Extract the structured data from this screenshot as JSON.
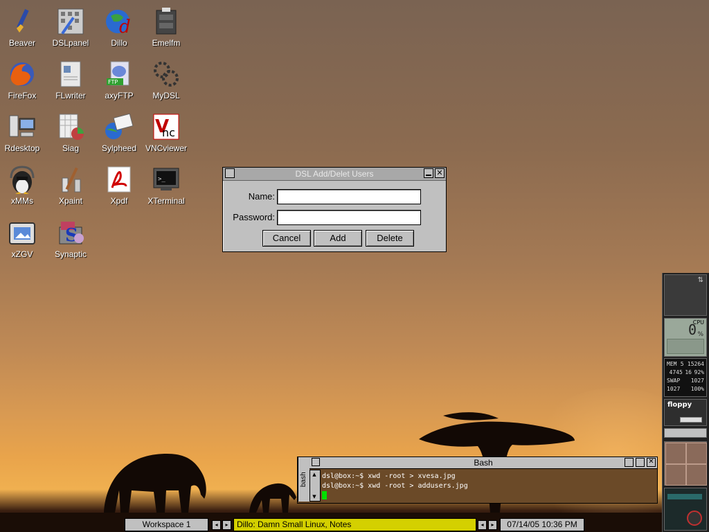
{
  "desktop_icons": [
    {
      "label": "Beaver",
      "icon": "beaver-icon"
    },
    {
      "label": "DSLpanel",
      "icon": "dslpanel-icon"
    },
    {
      "label": "Dillo",
      "icon": "dillo-icon"
    },
    {
      "label": "Emelfm",
      "icon": "emelfm-icon"
    },
    {
      "label": "FireFox",
      "icon": "firefox-icon"
    },
    {
      "label": "FLwriter",
      "icon": "flwriter-icon"
    },
    {
      "label": "axyFTP",
      "icon": "axyftp-icon"
    },
    {
      "label": "MyDSL",
      "icon": "mydsl-icon"
    },
    {
      "label": "Rdesktop",
      "icon": "rdesktop-icon"
    },
    {
      "label": "Siag",
      "icon": "siag-icon"
    },
    {
      "label": "Sylpheed",
      "icon": "sylpheed-icon"
    },
    {
      "label": "VNCviewer",
      "icon": "vncviewer-icon"
    },
    {
      "label": "xMMs",
      "icon": "xmms-icon"
    },
    {
      "label": "Xpaint",
      "icon": "xpaint-icon"
    },
    {
      "label": "Xpdf",
      "icon": "xpdf-icon"
    },
    {
      "label": "XTerminal",
      "icon": "xterminal-icon"
    },
    {
      "label": "xZGV",
      "icon": "xzgv-icon"
    },
    {
      "label": "Synaptic",
      "icon": "synaptic-icon"
    }
  ],
  "dialog": {
    "title": "DSL Add/Delet Users",
    "name_label": "Name:",
    "name_value": "",
    "password_label": "Password:",
    "password_value": "",
    "cancel_label": "Cancel",
    "add_label": "Add",
    "delete_label": "Delete"
  },
  "terminal": {
    "side_label": "bash",
    "title": "Bash",
    "lines": [
      "dsl@box:~$ xwd -root > xvesa.jpg",
      "dsl@box:~$ xwd -root > addusers.jpg"
    ]
  },
  "taskbar": {
    "workspace": "Workspace 1",
    "task": "Dillo: Damn Small Linux, Notes",
    "clock": "07/14/05 10:36 PM"
  },
  "dock": {
    "cpu_label": "CPU",
    "cpu_value": "0",
    "cpu_unit": "%",
    "mem_rows": [
      [
        "MEM",
        "5",
        "15264"
      ],
      [
        "",
        "4745",
        "16",
        "92%"
      ],
      [
        "SWAP",
        "",
        "1027"
      ],
      [
        "1027",
        "",
        "100%"
      ]
    ],
    "floppy_label": "floppy"
  },
  "colors": {
    "dialog_bg": "#c0c0c0",
    "cursor": "#00e000",
    "terminal_bg": "#6b4a28"
  }
}
